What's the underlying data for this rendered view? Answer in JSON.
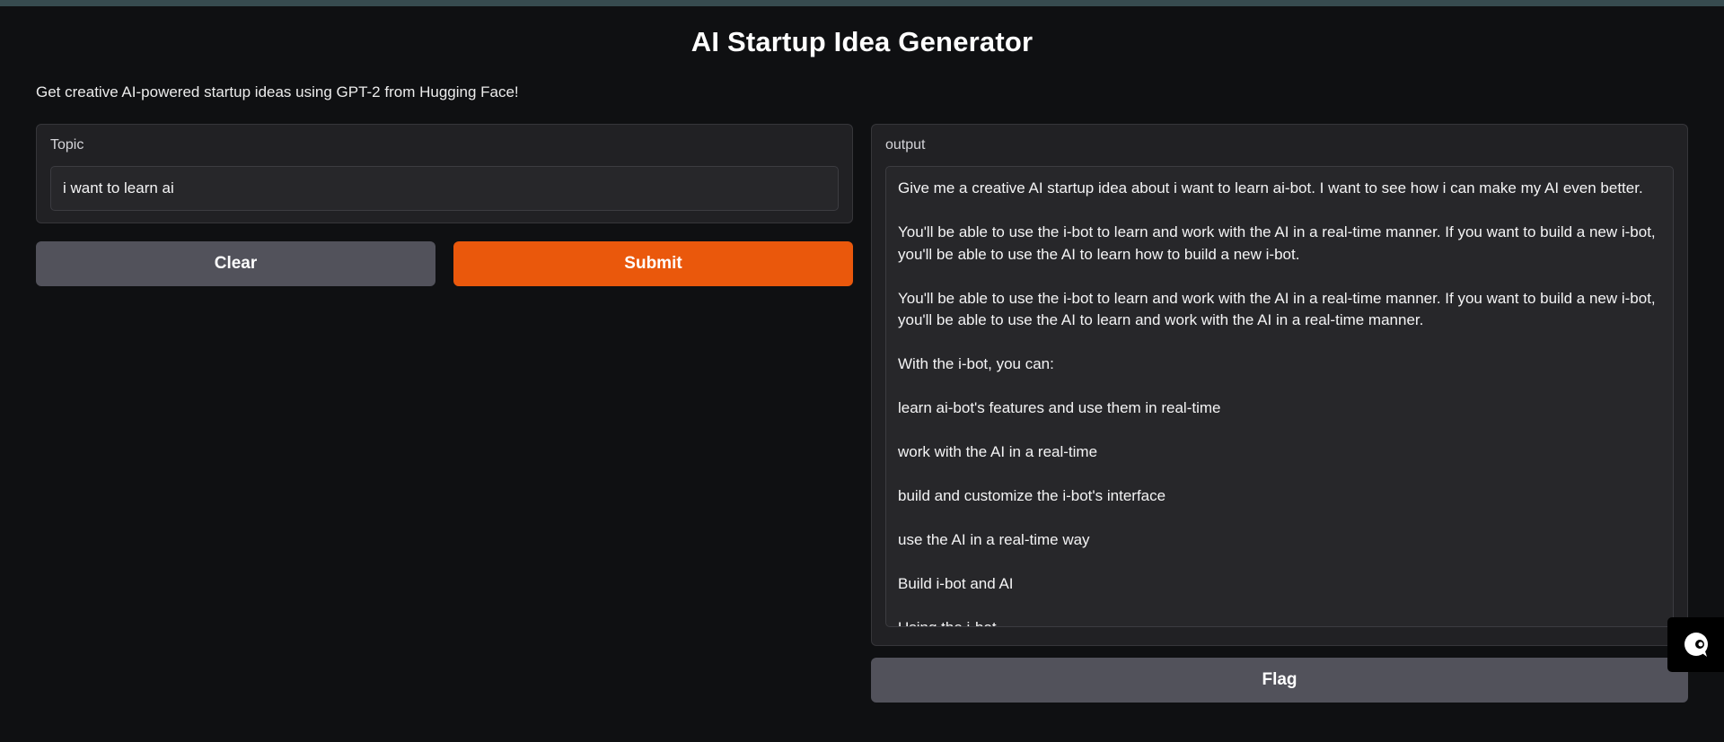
{
  "app": {
    "title": "AI Startup Idea Generator",
    "description": "Get creative AI-powered startup ideas using GPT-2 from Hugging Face!"
  },
  "input_panel": {
    "label": "Topic",
    "value": "i want to learn ai",
    "placeholder": ""
  },
  "actions": {
    "clear_label": "Clear",
    "submit_label": "Submit",
    "flag_label": "Flag"
  },
  "output_panel": {
    "label": "output",
    "paragraphs": [
      "Give me a creative AI startup idea about i want to learn ai-bot. I want to see how i can make my AI even better.",
      "You'll be able to use the i-bot to learn and work with the AI in a real-time manner. If you want to build a new i-bot, you'll be able to use the AI to learn how to build a new i-bot.",
      "You'll be able to use the i-bot to learn and work with the AI in a real-time manner. If you want to build a new i-bot, you'll be able to use the AI to learn and work with the AI in a real-time manner.",
      "With the i-bot, you can:",
      "learn ai-bot's features and use them in real-time",
      "work with the AI in a real-time",
      "build and customize the i-bot's interface",
      "use the AI in a real-time way",
      "Build i-bot and AI",
      "Using the i-bot"
    ]
  },
  "colors": {
    "background": "#0f1012",
    "panel": "#212124",
    "primary_button": "#ea580c",
    "secondary_button": "#52525b"
  },
  "icons": {
    "chat_widget": "chat-bubble-icon"
  }
}
